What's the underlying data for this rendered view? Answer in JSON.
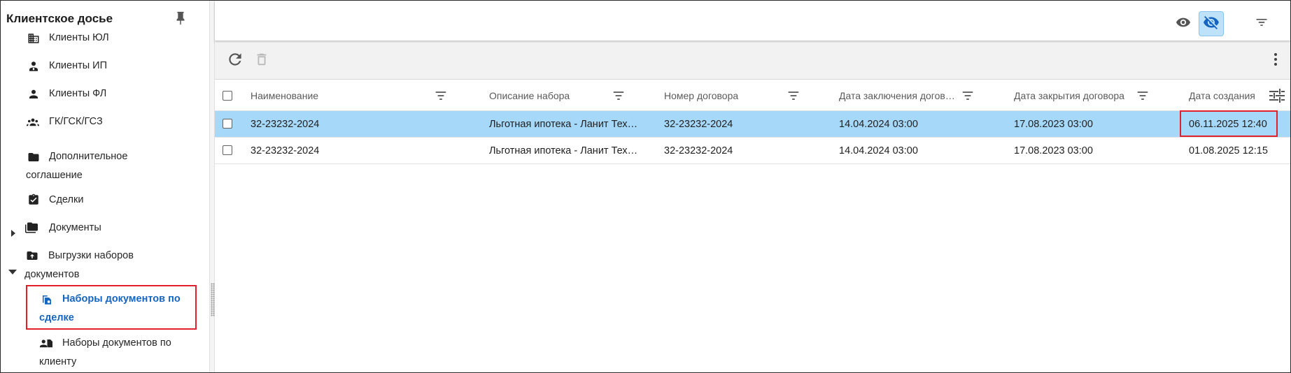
{
  "sidebar": {
    "title": "Клиентское досье",
    "items": [
      {
        "label": "Клиенты ЮЛ",
        "icon": "building-icon"
      },
      {
        "label": "Клиенты ИП",
        "icon": "person-badge-icon"
      },
      {
        "label": "Клиенты ФЛ",
        "icon": "person-icon"
      },
      {
        "label": "ГК/ГСК/ГСЗ",
        "icon": "group-icon"
      },
      {
        "label_line1": "Дополнительное",
        "label_line2": "соглашение",
        "icon": "folder-icon"
      },
      {
        "label": "Сделки",
        "icon": "clipboard-check-icon"
      },
      {
        "label": "Документы",
        "icon": "folders-icon"
      },
      {
        "label_line1": "Выгрузки наборов",
        "label_line2": "документов",
        "icon": "folder-upload-icon"
      },
      {
        "label_line1": "Наборы документов по",
        "label_line2": "сделке",
        "icon": "file-copy-icon"
      },
      {
        "label_line1": "Наборы документов по",
        "label_line2": "клиенту",
        "icon": "person-doc-icon"
      }
    ]
  },
  "table": {
    "columns": [
      "Наименование",
      "Описание набора",
      "Номер договора",
      "Дата заключения догов…",
      "Дата закрытия договора",
      "Дата создания"
    ],
    "rows": [
      [
        "32-23232-2024",
        "Льготная ипотека - Ланит Тех…",
        "32-23232-2024",
        "14.04.2024 03:00",
        "17.08.2023 03:00",
        "06.11.2025 12:40"
      ],
      [
        "32-23232-2024",
        "Льготная ипотека - Ланит Тех…",
        "32-23232-2024",
        "14.04.2024 03:00",
        "17.08.2023 03:00",
        "01.08.2025 12:15"
      ]
    ]
  },
  "colors": {
    "accent": "#1565c0",
    "selected_row": "#a6d8fa",
    "highlight": "#e0202a",
    "toggle_active": "#bfe2fb"
  }
}
